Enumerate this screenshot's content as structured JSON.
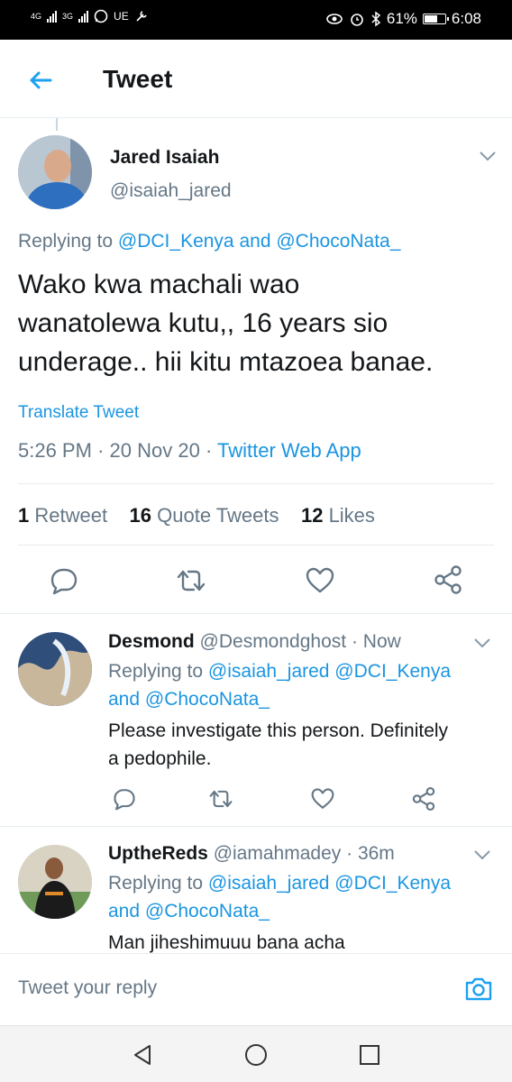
{
  "status_bar": {
    "network_1": "4G",
    "network_2": "3G",
    "carrier_label": "UE",
    "battery": "61%",
    "time": "6:08"
  },
  "header": {
    "title": "Tweet"
  },
  "tweet": {
    "author_name": "Jared Isaiah",
    "author_handle": "@isaiah_jared",
    "replying_prefix": "Replying to",
    "replying_user_1": "@DCI_Kenya",
    "replying_and": "and",
    "replying_user_2": "@ChocoNata_",
    "text_line_1": "Wako kwa machali wao",
    "text_line_2": "wanatolewa kutu,, 16 years sio",
    "text_line_3": "underage.. hii kitu mtazoea banae.",
    "translate_label": "Translate Tweet",
    "time": "5:26 PM",
    "date": "20 Nov 20",
    "source": "Twitter Web App",
    "dot": "·",
    "stats": {
      "retweets_count": "1",
      "retweets_label": "Retweet",
      "quotes_count": "16",
      "quotes_label": "Quote Tweets",
      "likes_count": "12",
      "likes_label": "Likes"
    }
  },
  "replies": [
    {
      "name": "Desmond",
      "handle": "@Desmondghost",
      "time": "Now",
      "replying_prefix": "Replying to",
      "users_line": "@isaiah_jared @DCI_Kenya",
      "and": "and",
      "last_user": "@ChocoNata_",
      "text_line_1": "Please investigate this person. Definitely",
      "text_line_2": "a pedophile."
    },
    {
      "name": "UptheReds",
      "handle": "@iamahmadey",
      "time": "36m",
      "replying_prefix": "Replying to",
      "users_line": "@isaiah_jared @DCI_Kenya",
      "and": "and",
      "last_user": "@ChocoNata_",
      "text_line_1": "Man jiheshimuuu bana acha"
    }
  ],
  "composer": {
    "placeholder": "Tweet your reply"
  },
  "icons": {
    "back": "arrow-left-icon",
    "more": "chevron-down-icon",
    "reply": "comment-icon",
    "retweet": "retweet-icon",
    "like": "heart-icon",
    "share": "share-icon",
    "camera": "camera-icon",
    "nav_back": "triangle-back-icon",
    "nav_home": "circle-home-icon",
    "nav_recent": "square-recents-icon"
  },
  "colors": {
    "accent": "#1da1f2",
    "link": "#1b95e0",
    "secondary_text": "#657786"
  }
}
